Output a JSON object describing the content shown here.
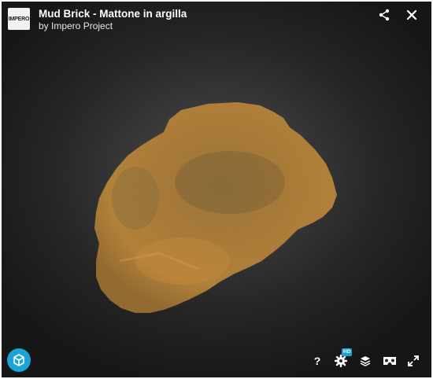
{
  "header": {
    "logo_text": "IMPERO",
    "title": "Mud Brick - Mattone in argilla",
    "author": "by Impero Project"
  },
  "icons": {
    "share": "share-icon",
    "close": "close-icon",
    "viewer": "cube-icon",
    "help": "help-icon",
    "settings": "settings-icon",
    "layers": "layers-icon",
    "vr": "vr-icon",
    "fullscreen": "fullscreen-icon"
  },
  "controls": {
    "help_label": "?",
    "hd_badge": "HD"
  },
  "colors": {
    "accent": "#1ba2d6",
    "background": "#2a2a2a",
    "brick": "#b77a2e"
  }
}
